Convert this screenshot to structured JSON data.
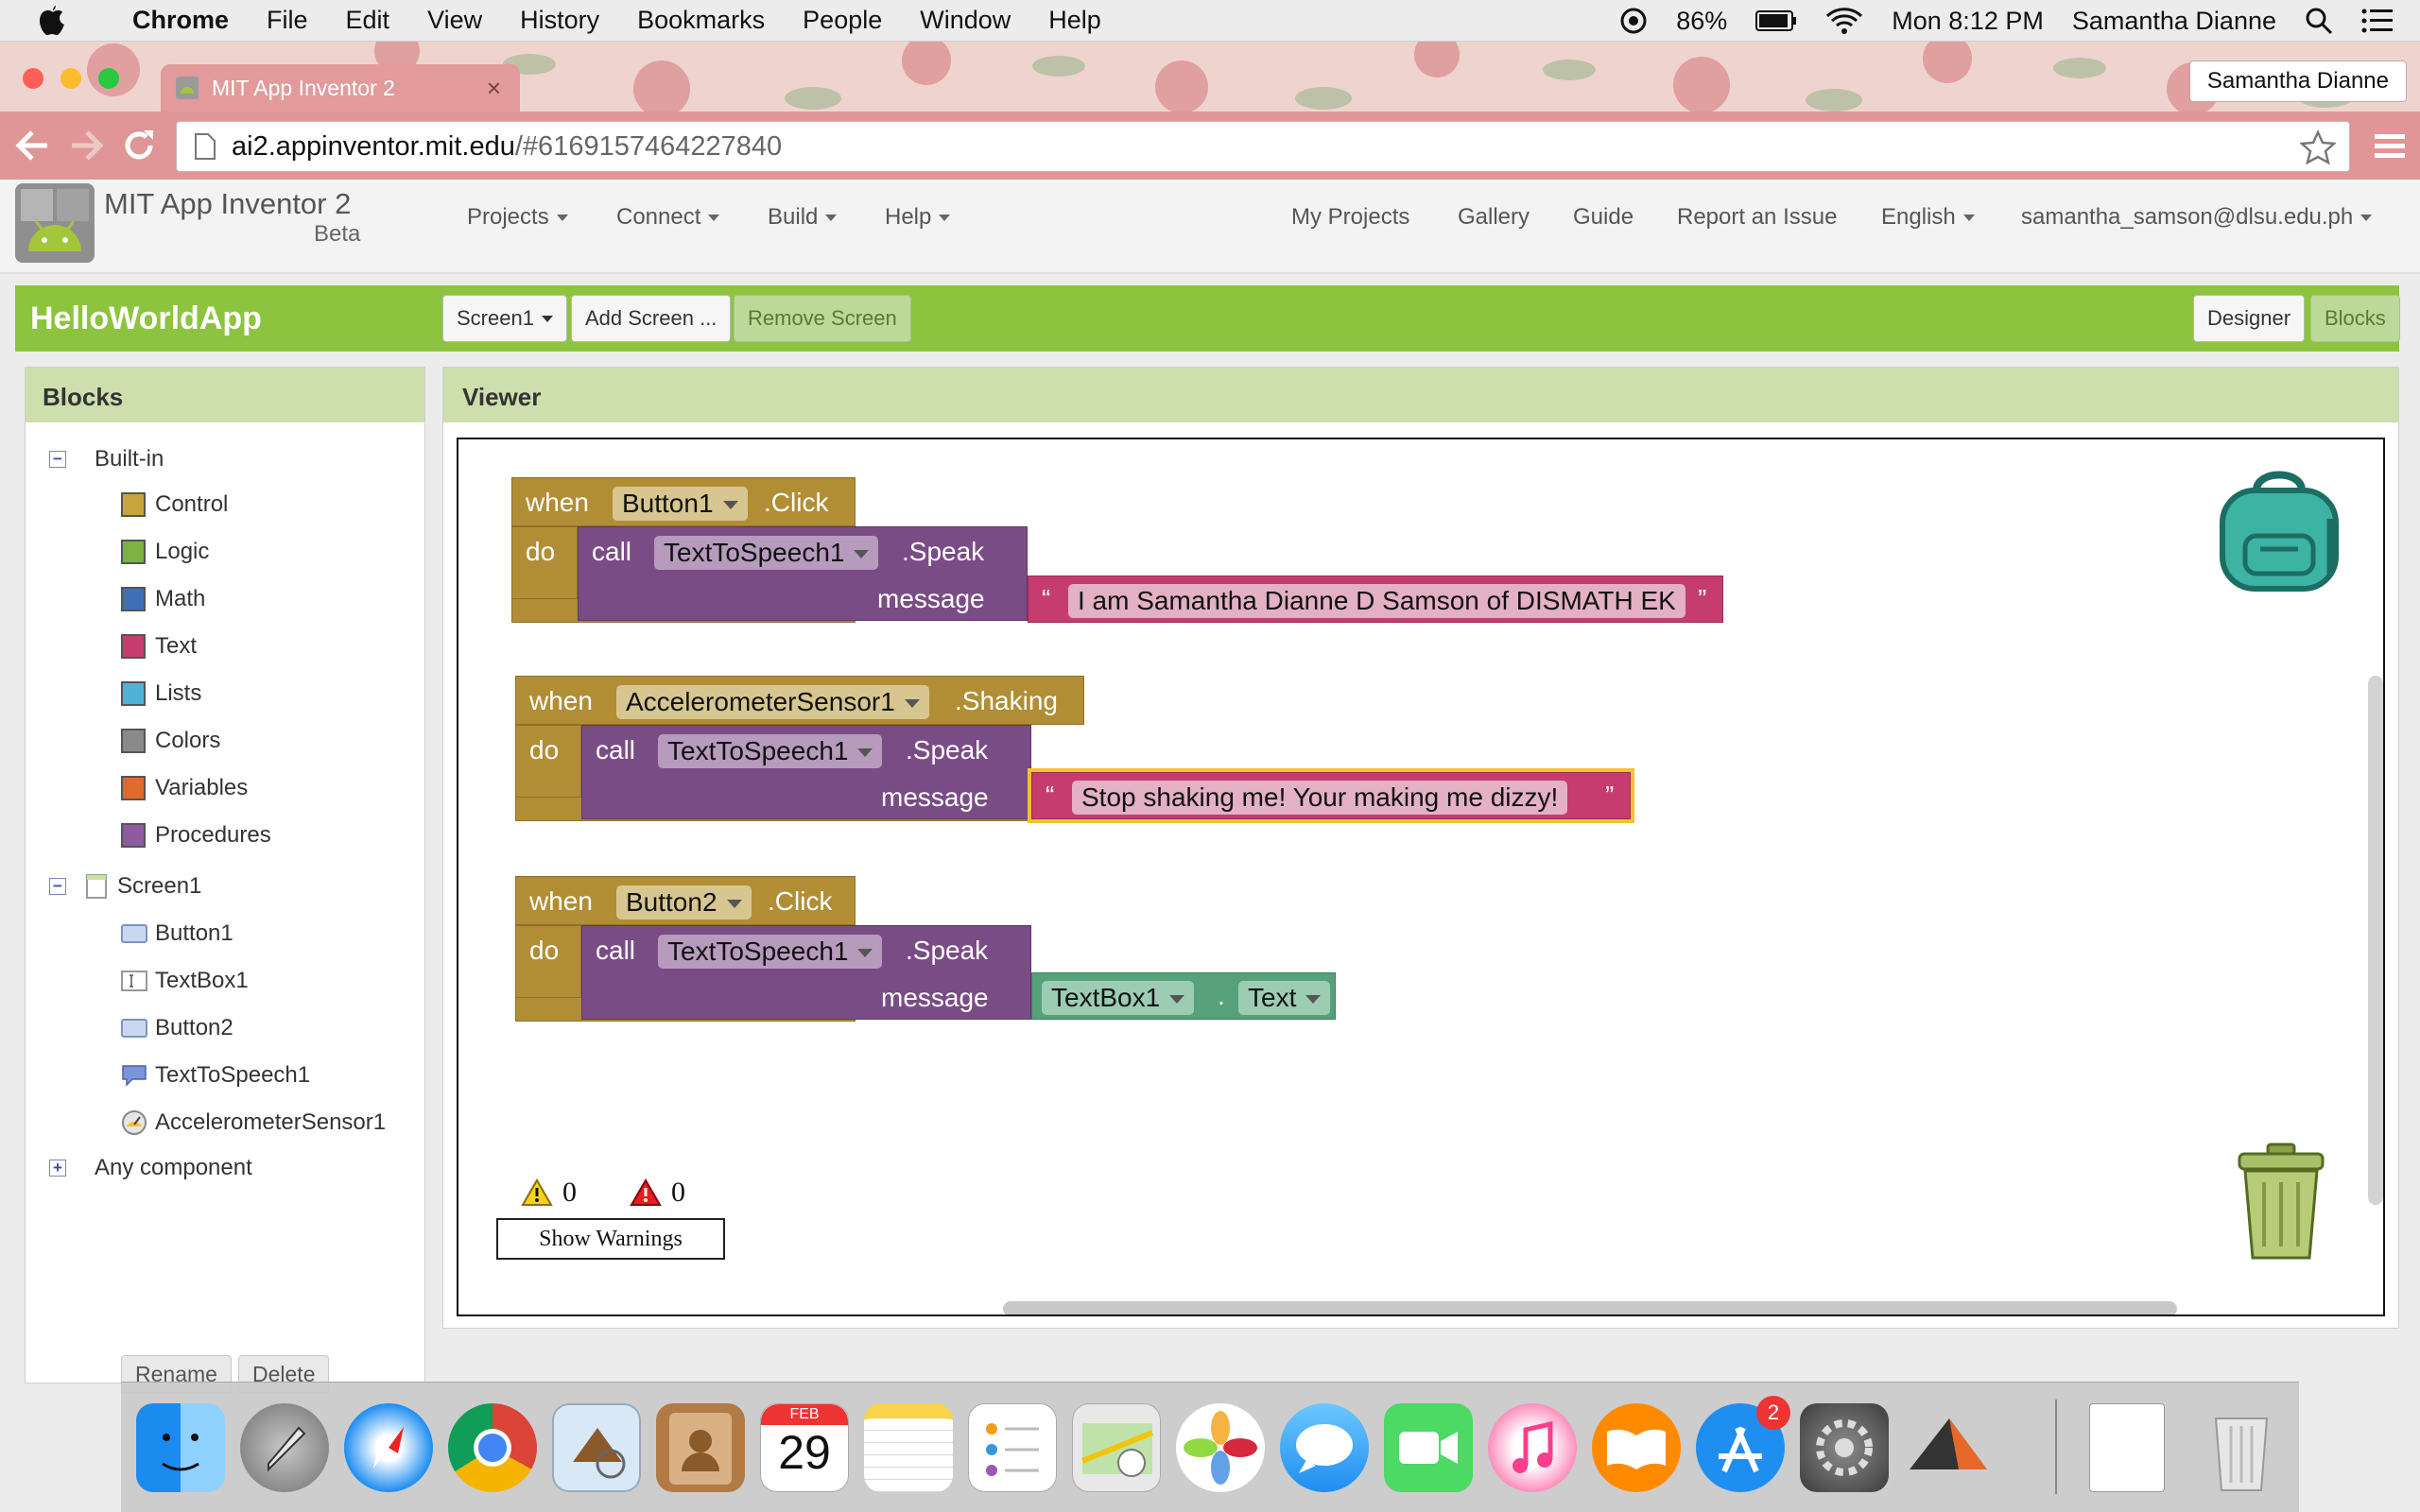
{
  "macos": {
    "app_name": "Chrome",
    "menus": [
      "File",
      "Edit",
      "View",
      "History",
      "Bookmarks",
      "People",
      "Window",
      "Help"
    ],
    "battery": "86%",
    "clock": "Mon 8:12 PM",
    "user": "Samantha Dianne"
  },
  "browser": {
    "tab_title": "MIT App Inventor 2",
    "tab_close": "×",
    "profile": "Samantha Dianne",
    "url_host": "ai2.appinventor.mit.edu",
    "url_path": "/#6169157464227840"
  },
  "appinventor": {
    "title": "MIT App Inventor 2",
    "beta": "Beta",
    "menus_left": [
      "Projects",
      "Connect",
      "Build",
      "Help"
    ],
    "menus_right": [
      "My Projects",
      "Gallery",
      "Guide",
      "Report an Issue"
    ],
    "language": "English",
    "account": "samantha_samson@dlsu.edu.ph"
  },
  "project": {
    "name": "HelloWorldApp",
    "screen_select": "Screen1",
    "add_screen": "Add Screen ...",
    "remove_screen": "Remove Screen",
    "designer": "Designer",
    "blocks": "Blocks"
  },
  "blocks_panel": {
    "header": "Blocks",
    "builtin": "Built-in",
    "builtin_items": [
      {
        "label": "Control",
        "color": "#c9a33d"
      },
      {
        "label": "Logic",
        "color": "#7cb342"
      },
      {
        "label": "Math",
        "color": "#3f6fb5"
      },
      {
        "label": "Text",
        "color": "#c63c6f"
      },
      {
        "label": "Lists",
        "color": "#4fb3d8"
      },
      {
        "label": "Colors",
        "color": "#8a8a8a"
      },
      {
        "label": "Variables",
        "color": "#e06a2c"
      },
      {
        "label": "Procedures",
        "color": "#8e5aa0"
      }
    ],
    "screen": "Screen1",
    "components": [
      "Button1",
      "TextBox1",
      "Button2",
      "TextToSpeech1",
      "AccelerometerSensor1"
    ],
    "any_component": "Any component",
    "rename": "Rename",
    "delete": "Delete"
  },
  "viewer": {
    "header": "Viewer",
    "blocks": [
      {
        "when": "when",
        "component": "Button1",
        "event": ".Click",
        "do": "do",
        "call": "call",
        "target": "TextToSpeech1",
        "method": ".Speak",
        "message": "message",
        "text": "I am Samantha Dianne D Samson of DISMATH EK"
      },
      {
        "when": "when",
        "component": "AccelerometerSensor1",
        "event": ".Shaking",
        "do": "do",
        "call": "call",
        "target": "TextToSpeech1",
        "method": ".Speak",
        "message": "message",
        "text": "Stop shaking me! Your making me dizzy!"
      },
      {
        "when": "when",
        "component": "Button2",
        "event": ".Click",
        "do": "do",
        "call": "call",
        "target": "TextToSpeech1",
        "method": ".Speak",
        "message": "message",
        "getter_component": "TextBox1",
        "getter_dot": ".",
        "getter_property": "Text"
      }
    ],
    "quote_open": "“",
    "quote_close": "”",
    "warnings_count": "0",
    "errors_count": "0",
    "show_warnings": "Show Warnings"
  },
  "dock": {
    "calendar_month": "FEB",
    "calendar_day": "29",
    "appstore_badge": "2"
  }
}
